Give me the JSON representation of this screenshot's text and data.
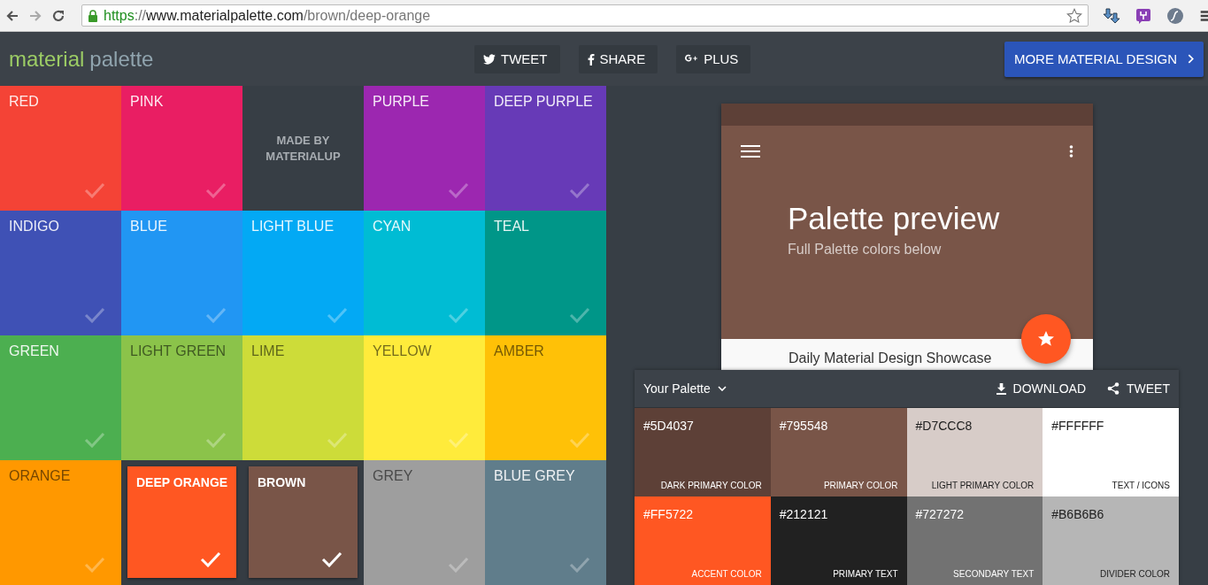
{
  "browser": {
    "url_scheme": "https",
    "url_sep": "://",
    "url_host": "www.materialpalette.com",
    "url_path": "/brown/deep-orange"
  },
  "header": {
    "logo_first": "material",
    "logo_second": "palette",
    "share_buttons": [
      {
        "kind": "twitter",
        "label": "TWEET"
      },
      {
        "kind": "facebook",
        "label": "SHARE"
      },
      {
        "kind": "gplus",
        "label": "PLUS"
      }
    ],
    "more_button": "MORE MATERIAL DESIGN"
  },
  "tiles": [
    {
      "kind": "color",
      "name": "RED",
      "color": "#f44336",
      "dark_label": false,
      "selected": false
    },
    {
      "kind": "color",
      "name": "PINK",
      "color": "#e91e63",
      "dark_label": false,
      "selected": false
    },
    {
      "kind": "credit",
      "name": "MADE BY MATERIALUP"
    },
    {
      "kind": "color",
      "name": "PURPLE",
      "color": "#9c27b0",
      "dark_label": false,
      "selected": false
    },
    {
      "kind": "color",
      "name": "DEEP PURPLE",
      "color": "#673ab7",
      "dark_label": false,
      "selected": false
    },
    {
      "kind": "color",
      "name": "INDIGO",
      "color": "#3f51b5",
      "dark_label": false,
      "selected": false
    },
    {
      "kind": "color",
      "name": "BLUE",
      "color": "#2196f3",
      "dark_label": false,
      "selected": false
    },
    {
      "kind": "color",
      "name": "LIGHT BLUE",
      "color": "#03a9f4",
      "dark_label": false,
      "selected": false
    },
    {
      "kind": "color",
      "name": "CYAN",
      "color": "#00bcd4",
      "dark_label": false,
      "selected": false
    },
    {
      "kind": "color",
      "name": "TEAL",
      "color": "#009688",
      "dark_label": false,
      "selected": false
    },
    {
      "kind": "color",
      "name": "GREEN",
      "color": "#4caf50",
      "dark_label": false,
      "selected": false
    },
    {
      "kind": "color",
      "name": "LIGHT GREEN",
      "color": "#8bc34a",
      "dark_label": true,
      "selected": false
    },
    {
      "kind": "color",
      "name": "LIME",
      "color": "#cddc39",
      "dark_label": true,
      "selected": false
    },
    {
      "kind": "color",
      "name": "YELLOW",
      "color": "#ffeb3b",
      "dark_label": true,
      "selected": false
    },
    {
      "kind": "color",
      "name": "AMBER",
      "color": "#ffc107",
      "dark_label": true,
      "selected": false
    },
    {
      "kind": "color",
      "name": "ORANGE",
      "color": "#ff9800",
      "dark_label": true,
      "selected": false
    },
    {
      "kind": "color",
      "name": "DEEP ORANGE",
      "color": "#ff5722",
      "dark_label": false,
      "selected": true
    },
    {
      "kind": "color",
      "name": "BROWN",
      "color": "#795548",
      "dark_label": false,
      "selected": true
    },
    {
      "kind": "color",
      "name": "GREY",
      "color": "#9e9e9e",
      "dark_label": true,
      "selected": false
    },
    {
      "kind": "color",
      "name": "BLUE GREY",
      "color": "#607d8b",
      "dark_label": false,
      "selected": false
    }
  ],
  "preview": {
    "title": "Palette preview",
    "subtitle": "Full Palette colors below",
    "body_text": "Daily Material Design Showcase"
  },
  "palette": {
    "title": "Your Palette",
    "actions": [
      {
        "kind": "download",
        "label": "DOWNLOAD"
      },
      {
        "kind": "share",
        "label": "TWEET"
      }
    ],
    "swatches": [
      {
        "hex": "#5D4037",
        "label": "DARK PRIMARY COLOR",
        "color": "#5d4037"
      },
      {
        "hex": "#795548",
        "label": "PRIMARY COLOR",
        "color": "#795548"
      },
      {
        "hex": "#D7CCC8",
        "label": "LIGHT PRIMARY COLOR",
        "color": "#d7ccc8"
      },
      {
        "hex": "#FFFFFF",
        "label": "TEXT / ICONS",
        "color": "#ffffff"
      },
      {
        "hex": "#FF5722",
        "label": "ACCENT COLOR",
        "color": "#ff5722"
      },
      {
        "hex": "#212121",
        "label": "PRIMARY TEXT",
        "color": "#212121"
      },
      {
        "hex": "#727272",
        "label": "SECONDARY TEXT",
        "color": "#727272"
      },
      {
        "hex": "#B6B6B6",
        "label": "DIVIDER COLOR",
        "color": "#b6b6b6"
      }
    ]
  }
}
